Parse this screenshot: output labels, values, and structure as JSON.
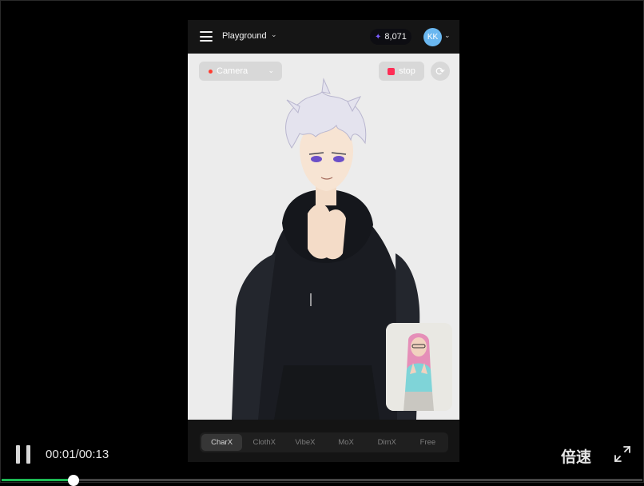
{
  "app": {
    "menu_icon": "hamburger-icon",
    "workspace_label": "Playground",
    "credits_icon": "sparkle-icon",
    "credits": "8,071",
    "avatar_initials": "KK"
  },
  "stage": {
    "camera_label": "Camera",
    "stop_label": "stop",
    "refresh_icon": "refresh-icon"
  },
  "tabs": [
    {
      "label": "CharX",
      "active": true
    },
    {
      "label": "ClothX",
      "active": false
    },
    {
      "label": "VibeX",
      "active": false
    },
    {
      "label": "MoX",
      "active": false
    },
    {
      "label": "DimX",
      "active": false
    },
    {
      "label": "Free",
      "active": false
    }
  ],
  "player": {
    "current_time": "00:01",
    "duration": "00:13",
    "time_display": "00:01/00:13",
    "speed_label": "倍速",
    "progress_fraction": 0.11,
    "progress_color": "#1db954",
    "state": "playing"
  },
  "colors": {
    "accent_record": "#ff2d55",
    "avatar_bg": "#6ab7f0",
    "credit_star": "#7a5cff"
  }
}
